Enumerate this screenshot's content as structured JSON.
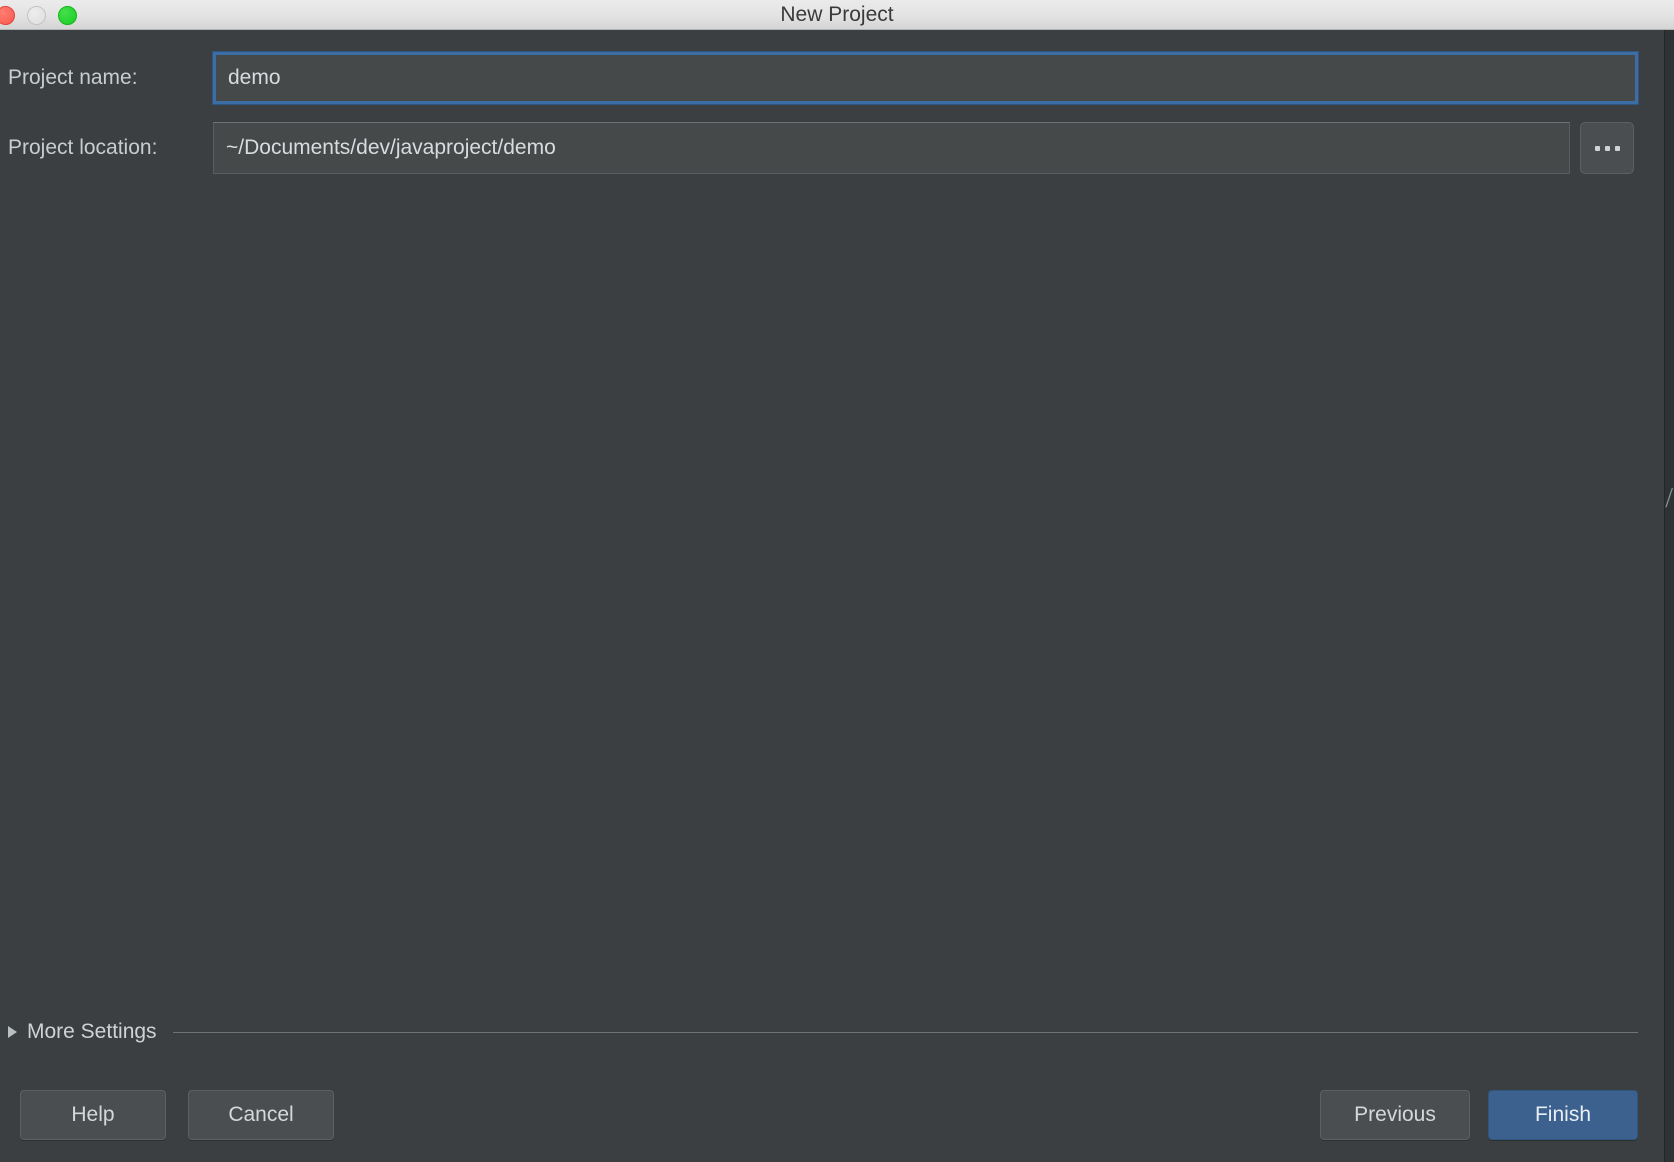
{
  "window": {
    "title": "New Project",
    "traffic_lights": [
      {
        "name": "close",
        "color": "#f8584f"
      },
      {
        "name": "minimize",
        "color": "#dedede"
      },
      {
        "name": "zoom",
        "color": "#17cc23"
      }
    ]
  },
  "form": {
    "project_name": {
      "label": "Project name:",
      "value": "demo",
      "placeholder": "",
      "focused": true
    },
    "project_location": {
      "label": "Project location:",
      "value": "~/Documents/dev/javaproject/demo",
      "placeholder": "",
      "focused": false,
      "browse_label": "..."
    }
  },
  "more_settings": {
    "label": "More Settings",
    "expanded": false
  },
  "buttons": {
    "help": "Help",
    "cancel": "Cancel",
    "previous": "Previous",
    "finish": "Finish"
  },
  "background": {
    "edge_glyph": "/"
  },
  "colors": {
    "window_background": "#3c3f41",
    "titlebar": "#e3e3e3",
    "input_background": "#45494a",
    "focus_border": "#3c6ea5",
    "default_button": "#3c618e",
    "text_primary": "#d4d8da"
  }
}
